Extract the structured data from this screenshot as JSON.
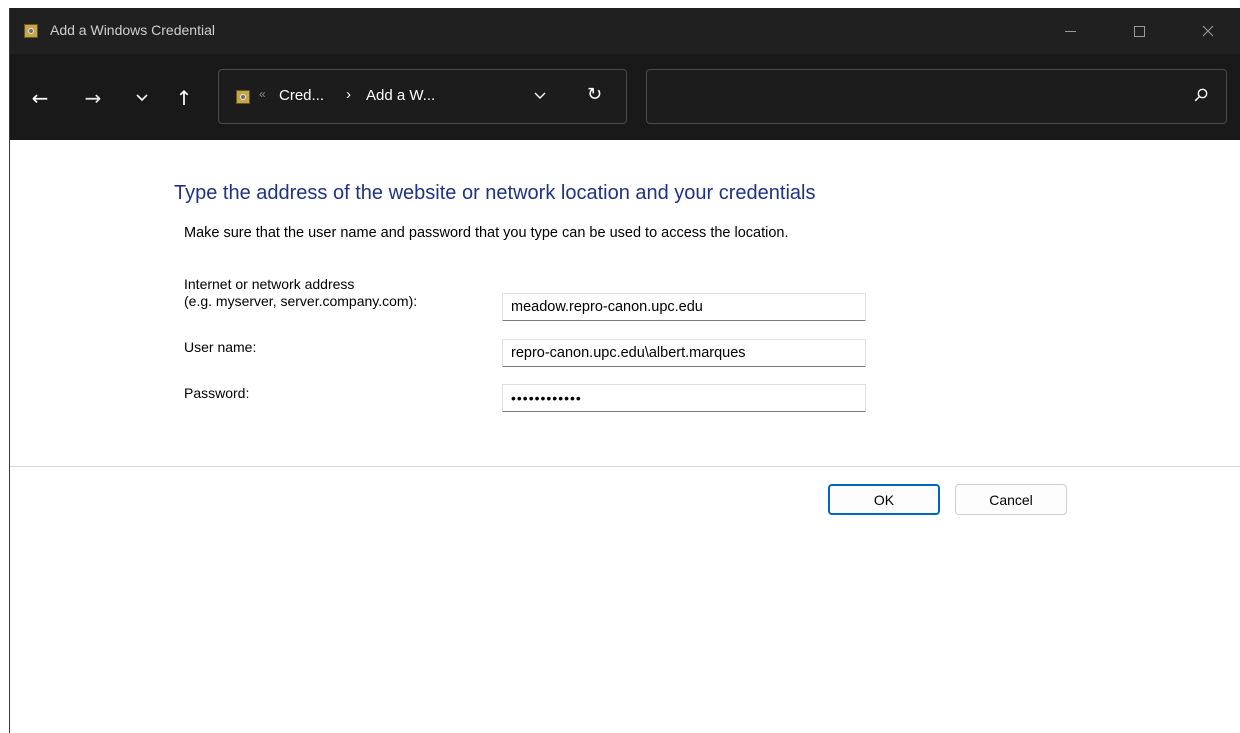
{
  "window": {
    "title": "Add a Windows Credential"
  },
  "nav": {
    "back_icon": "←",
    "forward_icon": "→",
    "recent_icon": "⌄",
    "up_icon": "↑",
    "breadcrumb_overflow": "«",
    "breadcrumb": [
      "Cred...",
      "Add a W..."
    ],
    "breadcrumb_separator": "›",
    "dropdown_icon": "⌄",
    "refresh_icon": "↻",
    "search_value": ""
  },
  "form": {
    "heading": "Type the address of the website or network location and your credentials",
    "description": "Make sure that the user name and password that you type can be used to access the location.",
    "address_label_line1": "Internet or network address",
    "address_label_line2": "(e.g. myserver, server.company.com):",
    "address_value": "meadow.repro-canon.upc.edu",
    "username_label": "User name:",
    "username_value": "repro-canon.upc.edu\\albert.marques",
    "password_label": "Password:",
    "password_value": "••••••••••••"
  },
  "buttons": {
    "ok_label": "OK",
    "cancel_label": "Cancel"
  },
  "colors": {
    "heading": "#1e3287",
    "accent": "#0067c0",
    "titlebar": "#202020"
  }
}
